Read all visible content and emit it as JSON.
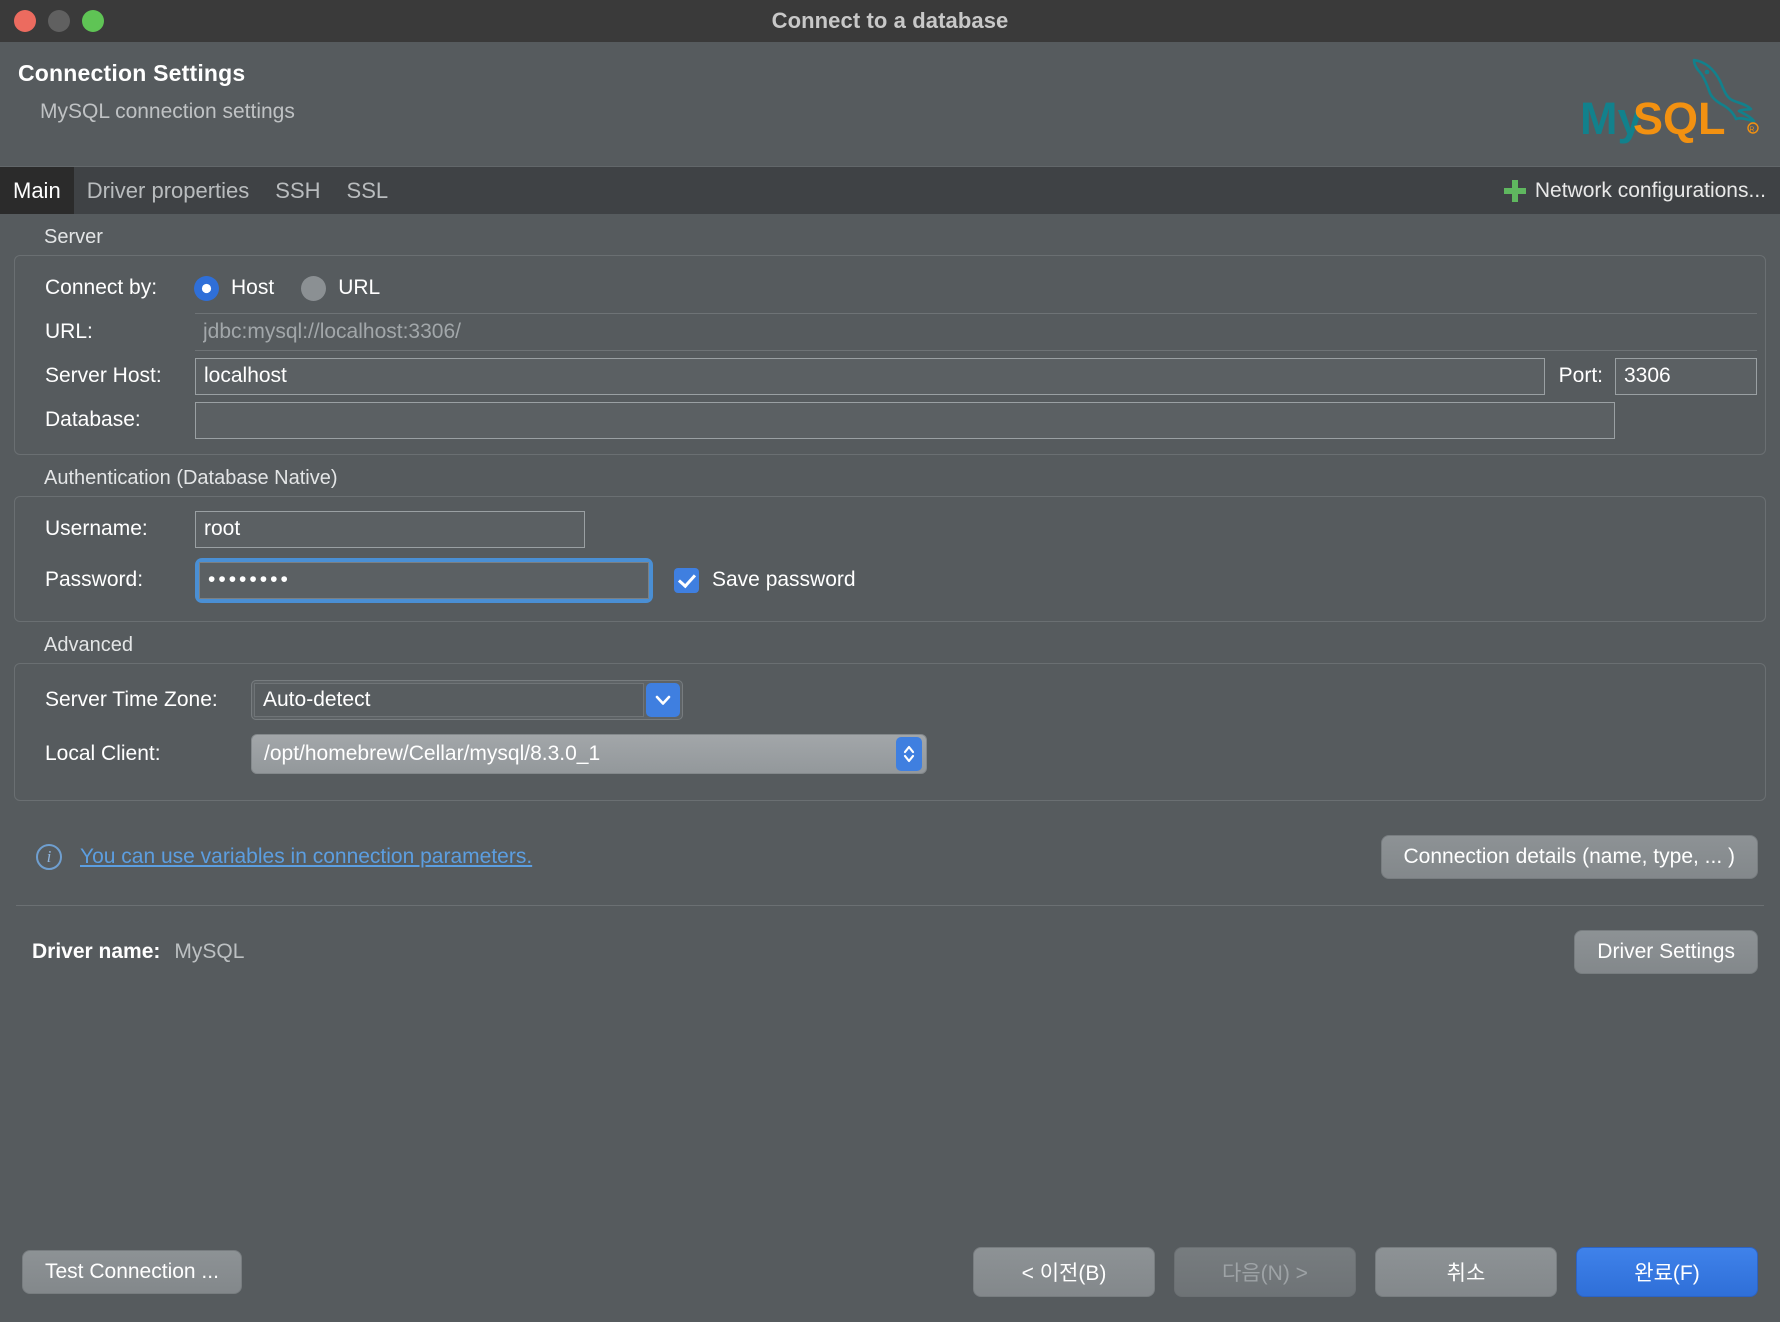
{
  "window": {
    "title": "Connect to a database",
    "traffic_lights": [
      "close",
      "minimize",
      "maximize"
    ]
  },
  "header": {
    "title": "Connection Settings",
    "subtitle": "MySQL connection settings",
    "logo": "mysql-logo",
    "logo_colors": {
      "my": "#14818c",
      "sql": "#f29111",
      "dolphin": "#00758f"
    }
  },
  "tabs": [
    {
      "label": "Main",
      "active": true
    },
    {
      "label": "Driver properties",
      "active": false
    },
    {
      "label": "SSH",
      "active": false
    },
    {
      "label": "SSL",
      "active": false
    }
  ],
  "network_configurations": {
    "label": "Network configurations...",
    "icon": "plus-icon",
    "icon_color": "#5fb75f"
  },
  "server": {
    "group_label": "Server",
    "connect_by": {
      "label": "Connect by:",
      "options": [
        "Host",
        "URL"
      ],
      "selected": "Host",
      "accent": "#2f6fd8"
    },
    "url": {
      "label": "URL:",
      "value": "",
      "placeholder": "jdbc:mysql://localhost:3306/"
    },
    "server_host": {
      "label": "Server Host:",
      "value": "localhost",
      "placeholder": ""
    },
    "port": {
      "label": "Port:",
      "value": "3306"
    },
    "database": {
      "label": "Database:",
      "value": "",
      "placeholder": ""
    }
  },
  "authentication": {
    "group_label": "Authentication (Database Native)",
    "username": {
      "label": "Username:",
      "value": "root",
      "placeholder": ""
    },
    "password": {
      "label": "Password:",
      "value": "••••••••",
      "placeholder": "",
      "focused": true
    },
    "save_password": {
      "label": "Save password",
      "checked": true,
      "accent": "#3f7fe0"
    }
  },
  "advanced": {
    "group_label": "Advanced",
    "server_time_zone": {
      "label": "Server Time Zone:",
      "value": "Auto-detect",
      "chevron": "chevron-down-icon"
    },
    "local_client": {
      "label": "Local Client:",
      "value": "/opt/homebrew/Cellar/mysql/8.3.0_1",
      "stepper": "up-down-stepper-icon"
    }
  },
  "info": {
    "icon": "info-icon",
    "link_text": "You can use variables in connection parameters.",
    "link_color": "#5c9ee0"
  },
  "connection_details_button": "Connection details (name, type, ... )",
  "driver": {
    "label": "Driver name:",
    "value": "MySQL",
    "settings_button": "Driver Settings"
  },
  "footer": {
    "test_connection": "Test Connection ...",
    "back": "< 이전(B)",
    "next": "다음(N) >",
    "next_disabled": true,
    "cancel": "취소",
    "finish": "완료(F)",
    "finish_accent": "#2f6fd8"
  }
}
